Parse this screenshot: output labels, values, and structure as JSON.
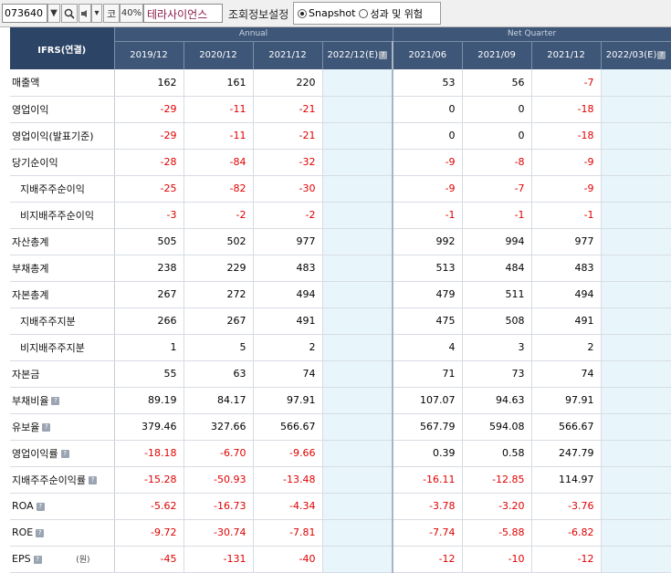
{
  "toolbar": {
    "code_value": "073640",
    "prefix_label": "코",
    "zoom_label": "40%",
    "company_name": "테라사이언스",
    "setting_label": "조회정보설정",
    "radio_snapshot": "Snapshot",
    "radio_performance": "성과 및 위험"
  },
  "header": {
    "ifrs_label": "IFRS(연결)",
    "annual_label": "Annual",
    "quarter_label": "Net Quarter",
    "annual_periods": [
      "2019/12",
      "2020/12",
      "2021/12",
      "2022/12(E)"
    ],
    "quarter_periods": [
      "2021/06",
      "2021/09",
      "2021/12",
      "2022/03(E)"
    ]
  },
  "rows": [
    {
      "label": "매출액",
      "sub": false,
      "help": false,
      "annual": [
        "162",
        "161",
        "220",
        ""
      ],
      "quarter": [
        "53",
        "56",
        "-7",
        ""
      ]
    },
    {
      "label": "영업이익",
      "sub": false,
      "help": false,
      "annual": [
        "-29",
        "-11",
        "-21",
        ""
      ],
      "quarter": [
        "0",
        "0",
        "-18",
        ""
      ]
    },
    {
      "label": "영업이익(발표기준)",
      "sub": false,
      "help": false,
      "annual": [
        "-29",
        "-11",
        "-21",
        ""
      ],
      "quarter": [
        "0",
        "0",
        "-18",
        ""
      ]
    },
    {
      "label": "당기순이익",
      "sub": false,
      "help": false,
      "annual": [
        "-28",
        "-84",
        "-32",
        ""
      ],
      "quarter": [
        "-9",
        "-8",
        "-9",
        ""
      ]
    },
    {
      "label": "지배주주순이익",
      "sub": true,
      "help": false,
      "annual": [
        "-25",
        "-82",
        "-30",
        ""
      ],
      "quarter": [
        "-9",
        "-7",
        "-9",
        ""
      ]
    },
    {
      "label": "비지배주주순이익",
      "sub": true,
      "help": false,
      "annual": [
        "-3",
        "-2",
        "-2",
        ""
      ],
      "quarter": [
        "-1",
        "-1",
        "-1",
        ""
      ]
    },
    {
      "label": "자산총계",
      "sub": false,
      "help": false,
      "annual": [
        "505",
        "502",
        "977",
        ""
      ],
      "quarter": [
        "992",
        "994",
        "977",
        ""
      ]
    },
    {
      "label": "부채총계",
      "sub": false,
      "help": false,
      "annual": [
        "238",
        "229",
        "483",
        ""
      ],
      "quarter": [
        "513",
        "484",
        "483",
        ""
      ]
    },
    {
      "label": "자본총계",
      "sub": false,
      "help": false,
      "annual": [
        "267",
        "272",
        "494",
        ""
      ],
      "quarter": [
        "479",
        "511",
        "494",
        ""
      ]
    },
    {
      "label": "지배주주지분",
      "sub": true,
      "help": false,
      "annual": [
        "266",
        "267",
        "491",
        ""
      ],
      "quarter": [
        "475",
        "508",
        "491",
        ""
      ]
    },
    {
      "label": "비지배주주지분",
      "sub": true,
      "help": false,
      "annual": [
        "1",
        "5",
        "2",
        ""
      ],
      "quarter": [
        "4",
        "3",
        "2",
        ""
      ]
    },
    {
      "label": "자본금",
      "sub": false,
      "help": false,
      "annual": [
        "55",
        "63",
        "74",
        ""
      ],
      "quarter": [
        "71",
        "73",
        "74",
        ""
      ]
    },
    {
      "label": "부채비율",
      "sub": false,
      "help": true,
      "annual": [
        "89.19",
        "84.17",
        "97.91",
        ""
      ],
      "quarter": [
        "107.07",
        "94.63",
        "97.91",
        ""
      ]
    },
    {
      "label": "유보율",
      "sub": false,
      "help": true,
      "annual": [
        "379.46",
        "327.66",
        "566.67",
        ""
      ],
      "quarter": [
        "567.79",
        "594.08",
        "566.67",
        ""
      ]
    },
    {
      "label": "영업이익률",
      "sub": false,
      "help": true,
      "annual": [
        "-18.18",
        "-6.70",
        "-9.66",
        ""
      ],
      "quarter": [
        "0.39",
        "0.58",
        "247.79",
        ""
      ]
    },
    {
      "label": "지배주주순이익률",
      "sub": false,
      "help": true,
      "annual": [
        "-15.28",
        "-50.93",
        "-13.48",
        ""
      ],
      "quarter": [
        "-16.11",
        "-12.85",
        "114.97",
        ""
      ]
    },
    {
      "label": "ROA",
      "sub": false,
      "help": true,
      "annual": [
        "-5.62",
        "-16.73",
        "-4.34",
        ""
      ],
      "quarter": [
        "-3.78",
        "-3.20",
        "-3.76",
        ""
      ]
    },
    {
      "label": "ROE",
      "sub": false,
      "help": true,
      "annual": [
        "-9.72",
        "-30.74",
        "-7.81",
        ""
      ],
      "quarter": [
        "-7.74",
        "-5.88",
        "-6.82",
        ""
      ]
    },
    {
      "label": "EPS",
      "sub": false,
      "help": true,
      "unit": "(원)",
      "annual": [
        "-45",
        "-131",
        "-40",
        ""
      ],
      "quarter": [
        "-12",
        "-10",
        "-12",
        ""
      ]
    }
  ],
  "colors": {
    "header_bg": "#3e5678",
    "estimate_bg": "#e8f6fc",
    "negative": "#e00000"
  }
}
